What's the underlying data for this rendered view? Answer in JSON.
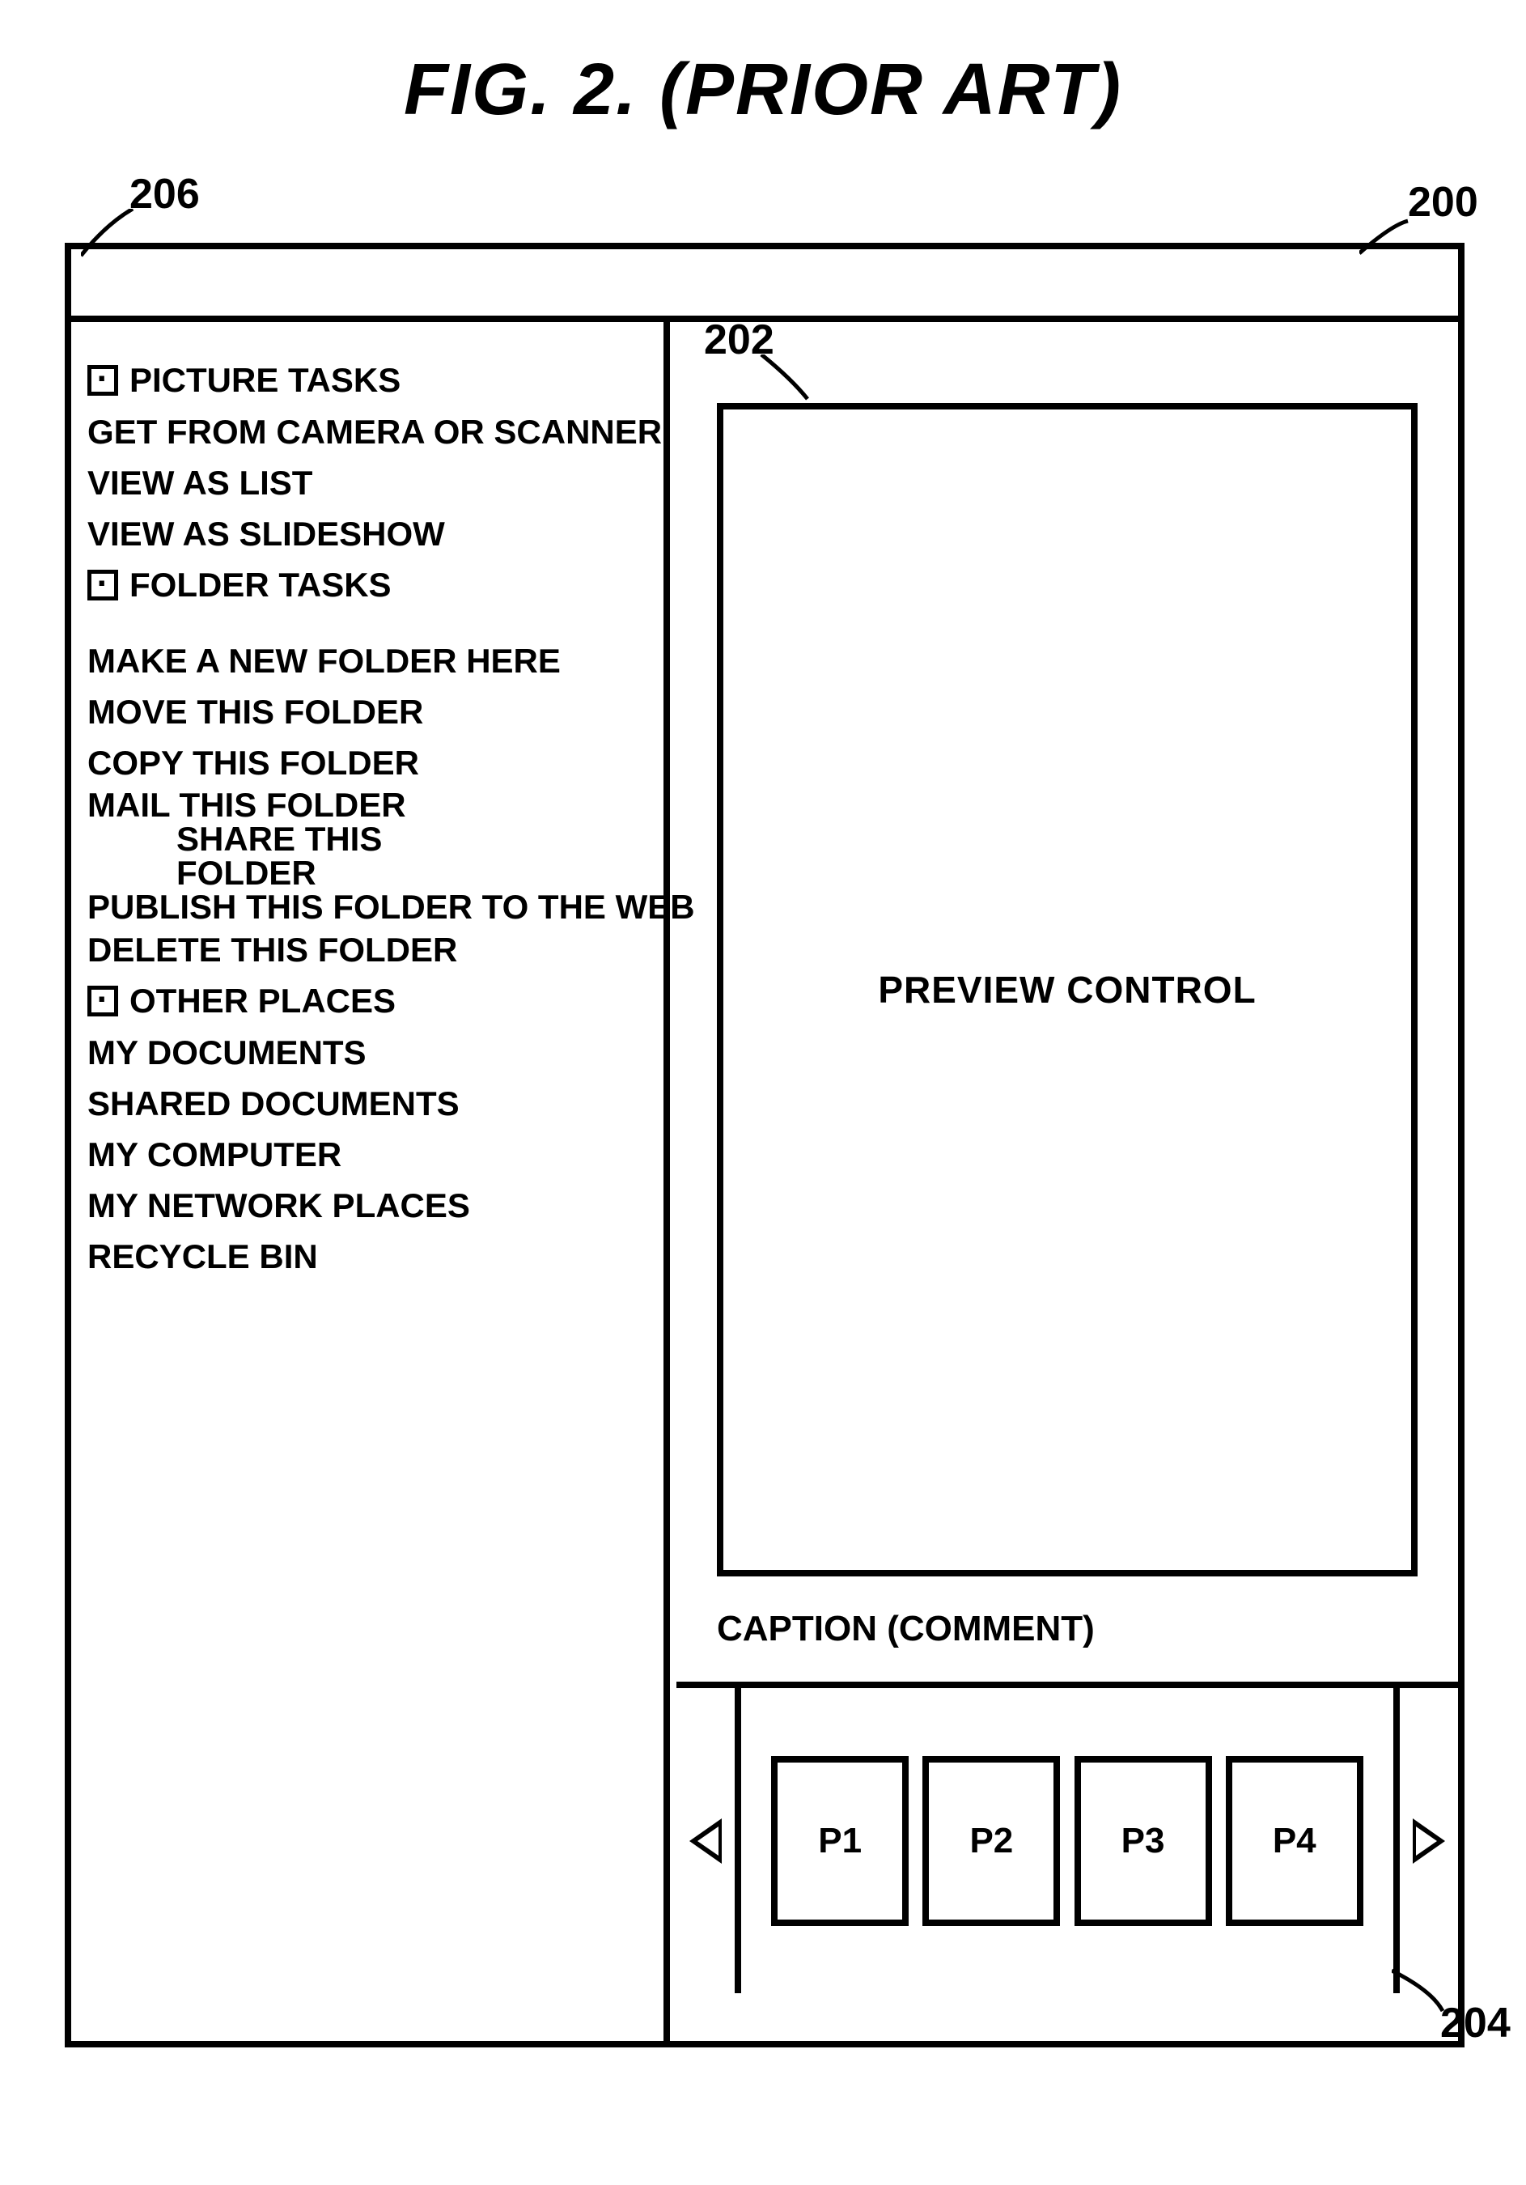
{
  "figure": {
    "title": "FIG. 2. (PRIOR ART)"
  },
  "sidebar": {
    "sections": [
      {
        "header": "PICTURE TASKS",
        "items": [
          "GET FROM CAMERA OR SCANNER",
          "VIEW AS LIST",
          "VIEW AS SLIDESHOW"
        ]
      },
      {
        "header": "FOLDER TASKS",
        "items": [
          "MAKE A NEW FOLDER HERE",
          "MOVE THIS FOLDER",
          "COPY THIS FOLDER",
          "MAIL THIS FOLDER",
          "SHARE THIS FOLDER",
          "PUBLISH THIS FOLDER TO THE WEB",
          "DELETE THIS FOLDER"
        ]
      },
      {
        "header": "OTHER PLACES",
        "items": [
          "MY DOCUMENTS",
          "SHARED DOCUMENTS",
          "MY COMPUTER",
          "MY NETWORK PLACES",
          "RECYCLE BIN"
        ]
      }
    ]
  },
  "main": {
    "preview_label": "PREVIEW CONTROL",
    "caption_label": "CAPTION (COMMENT)",
    "thumbnails": [
      "P1",
      "P2",
      "P3",
      "P4"
    ]
  },
  "callouts": {
    "window": "200",
    "preview": "202",
    "filmstrip": "204",
    "sidebar": "206"
  }
}
